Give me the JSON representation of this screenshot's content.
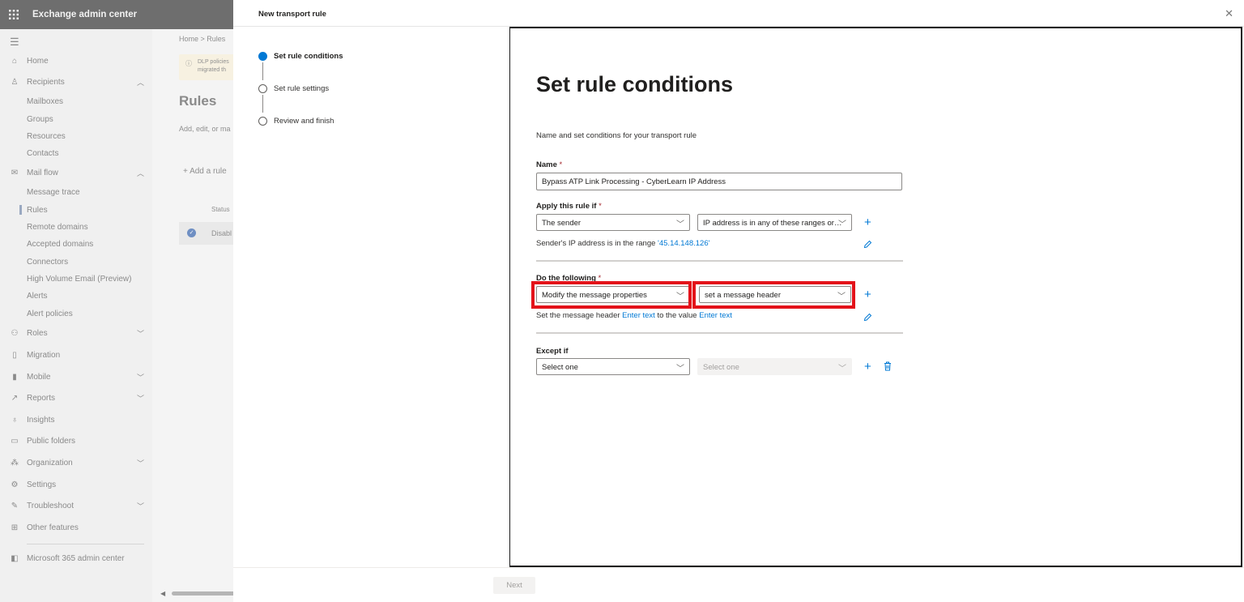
{
  "app": {
    "title": "Exchange admin center",
    "waffle_icon": "app-launcher-icon"
  },
  "nav": {
    "items": [
      {
        "label": "Home",
        "icon": "home-icon"
      },
      {
        "label": "Recipients",
        "icon": "person-icon"
      },
      {
        "label": "Mailboxes"
      },
      {
        "label": "Groups"
      },
      {
        "label": "Resources"
      },
      {
        "label": "Contacts"
      },
      {
        "label": "Mail flow",
        "icon": "mail-icon"
      },
      {
        "label": "Message trace"
      },
      {
        "label": "Rules"
      },
      {
        "label": "Remote domains"
      },
      {
        "label": "Accepted domains"
      },
      {
        "label": "Connectors"
      },
      {
        "label": "High Volume Email (Preview)"
      },
      {
        "label": "Alerts"
      },
      {
        "label": "Alert policies"
      },
      {
        "label": "Roles",
        "icon": "roles-icon"
      },
      {
        "label": "Migration",
        "icon": "migration-icon"
      },
      {
        "label": "Mobile",
        "icon": "mobile-icon"
      },
      {
        "label": "Reports",
        "icon": "reports-icon"
      },
      {
        "label": "Insights",
        "icon": "insights-icon"
      },
      {
        "label": "Public folders",
        "icon": "public-folders-icon"
      },
      {
        "label": "Organization",
        "icon": "organization-icon"
      },
      {
        "label": "Settings",
        "icon": "settings-icon"
      },
      {
        "label": "Troubleshoot",
        "icon": "troubleshoot-icon"
      },
      {
        "label": "Other features",
        "icon": "other-features-icon"
      },
      {
        "label": "Microsoft 365 admin center",
        "icon": "m365-icon"
      }
    ]
  },
  "background": {
    "breadcrumb": "Home  >  Rules",
    "banner_line1": "DLP policies",
    "banner_line2": "migrated th",
    "page_title": "Rules",
    "page_subtitle": "Add, edit, or ma",
    "add_rule": "Add a rule",
    "status_header": "Status",
    "row_status": "Disabl"
  },
  "panel": {
    "title": "New transport rule",
    "steps": [
      {
        "label": "Set rule conditions",
        "active": true
      },
      {
        "label": "Set rule settings",
        "active": false
      },
      {
        "label": "Review and finish",
        "active": false
      }
    ],
    "heading": "Set rule conditions",
    "description": "Name and set conditions for your transport rule",
    "name_label": "Name",
    "required_mark": "*",
    "name_value": "Bypass ATP Link Processing - CyberLearn IP Address",
    "apply_label": "Apply this rule if",
    "apply_dropdown1": "The sender",
    "apply_dropdown2": "IP address is in any of these ranges or…",
    "apply_summary_prefix": "Sender's IP address is in the range ",
    "apply_summary_link": "'45.14.148.126'",
    "do_label": "Do the following",
    "do_dropdown1": "Modify the message properties",
    "do_dropdown2": "set a message header",
    "do_summary_prefix": "Set the message header ",
    "do_summary_link1": "Enter text",
    "do_summary_mid": " to the value ",
    "do_summary_link2": "Enter text",
    "except_label": "Except if",
    "except_dropdown1": "Select one",
    "except_dropdown2": "Select one",
    "next_button": "Next",
    "highlight_color": "#e3121a",
    "accent_color": "#0078d4"
  }
}
